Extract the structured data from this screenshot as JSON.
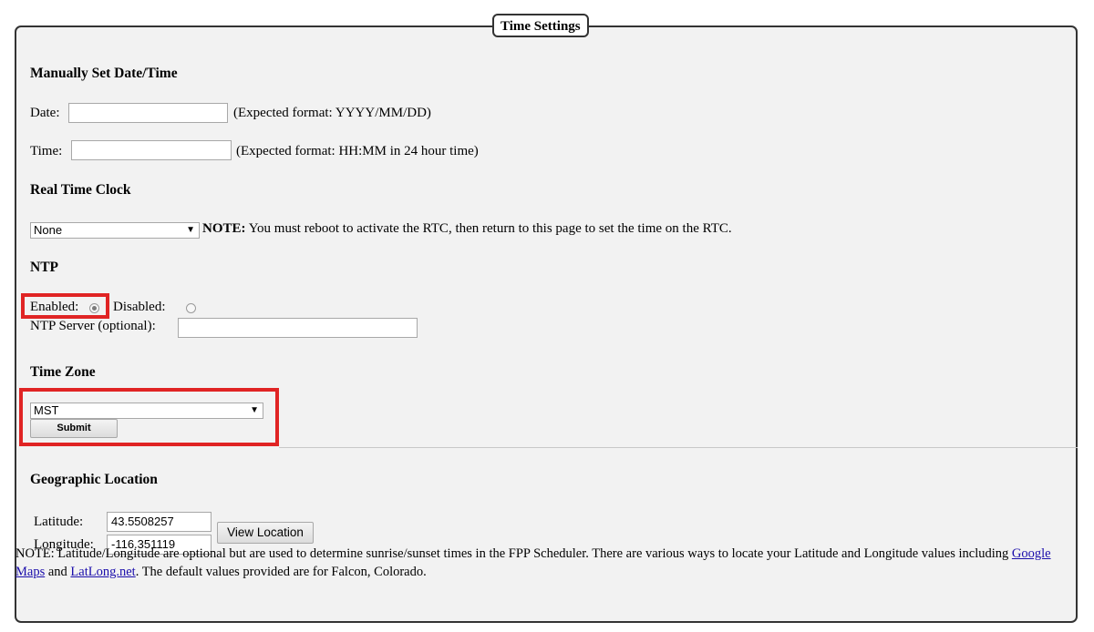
{
  "legend": "Time Settings",
  "manual": {
    "heading": "Manually Set Date/Time",
    "date_label": "Date:",
    "date_value": "",
    "date_hint": "(Expected format: YYYY/MM/DD)",
    "time_label": "Time:",
    "time_value": "",
    "time_hint": "(Expected format: HH:MM in 24 hour time)"
  },
  "rtc": {
    "heading": "Real Time Clock",
    "selected": "None",
    "note_label": "NOTE:",
    "note_text": "You must reboot to activate the RTC, then return to this page to set the time on the RTC."
  },
  "ntp": {
    "heading": "NTP",
    "enabled_label": "Enabled:",
    "disabled_label": "Disabled:",
    "enabled_checked": true,
    "server_label": "NTP Server (optional):",
    "server_value": ""
  },
  "timezone": {
    "heading": "Time Zone",
    "selected": "MST",
    "submit_label": "Submit"
  },
  "geo": {
    "heading": "Geographic Location",
    "latitude_label": "Latitude:",
    "latitude_value": "43.5508257",
    "longitude_label": "Longitude:",
    "longitude_value": "-116.351119",
    "view_button": "View Location",
    "note_part1": "NOTE: Latitude/Longitude are optional but are used to determine sunrise/sunset times in the FPP Scheduler. There are various ways to locate your Latitude and Longitude values including ",
    "link1": "Google Maps",
    "note_and": " and ",
    "link2": "LatLong.net",
    "note_part2": ". The default values provided are for Falcon, Colorado."
  },
  "colors": {
    "highlight": "#e02424",
    "panel_bg": "#f2f2f2",
    "link": "#1a0dab"
  },
  "icons": {
    "select_arrow": "triangle-down-icon"
  }
}
